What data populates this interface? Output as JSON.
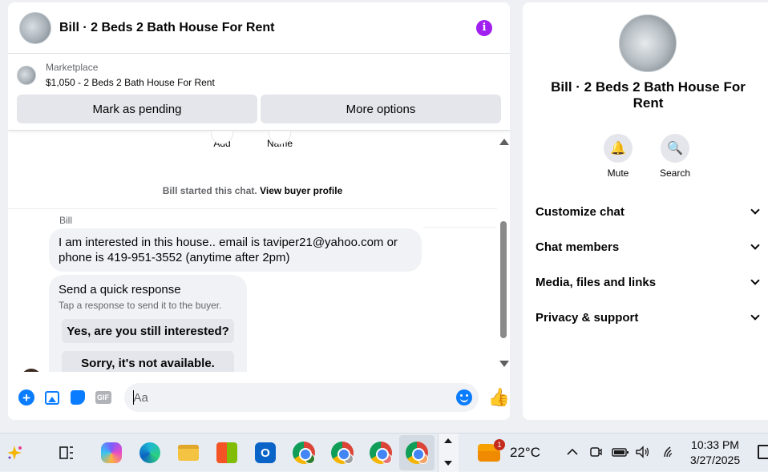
{
  "chat": {
    "title": "Bill · 2 Beds 2 Bath House For Rent",
    "marketplace": {
      "label": "Marketplace",
      "listing": "$1,050 - 2 Beds 2 Bath House For Rent",
      "buttons": [
        "Mark as pending",
        "More options"
      ]
    },
    "top_actions": [
      "Add",
      "Name"
    ],
    "system": {
      "text": "Bill started this chat.",
      "link": "View buyer profile"
    },
    "sender": "Bill",
    "message": "I am interested in this house.. email is taviper21@yahoo.com or phone is 419-951-3552 (anytime after 2pm)",
    "quick_response": {
      "title": "Send a quick response",
      "subtitle": "Tap a response to send it to the buyer.",
      "options": [
        "Yes, are you still interested?",
        "Sorry, it's not available."
      ]
    },
    "composer": {
      "placeholder": "Aa",
      "gif_label": "GIF"
    }
  },
  "info": {
    "name": "Bill · 2 Beds 2 Bath House For Rent",
    "actions": [
      {
        "label": "Mute",
        "icon": "bell-icon"
      },
      {
        "label": "Search",
        "icon": "search-icon"
      }
    ],
    "sections": [
      "Customize chat",
      "Chat members",
      "Media, files and links",
      "Privacy & support"
    ]
  },
  "taskbar": {
    "weather": {
      "temp": "22°C",
      "badge": "1"
    },
    "time": "10:33 PM",
    "date": "3/27/2025"
  },
  "colors": {
    "accent": "#0a7cff",
    "info": "#a020f0"
  }
}
